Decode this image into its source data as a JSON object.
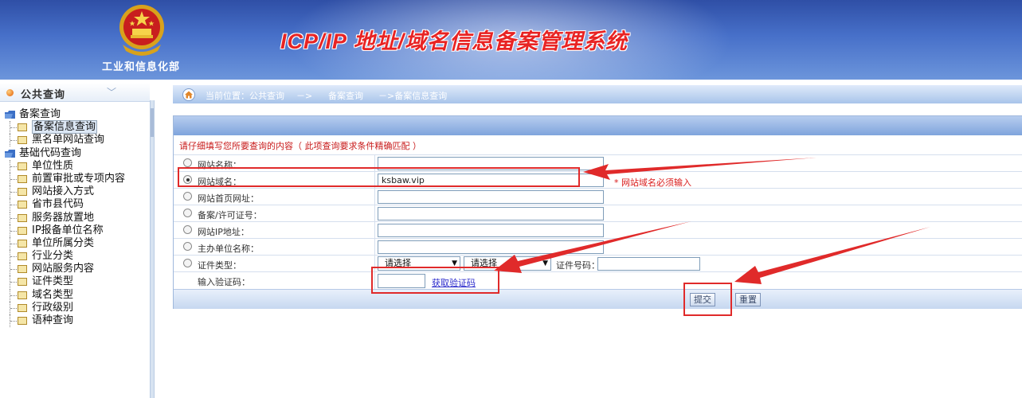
{
  "banner": {
    "ministry": "工业和信息化部",
    "title": "ICP/IP 地址/域名信息备案管理系统"
  },
  "sidebar": {
    "header": "公共查询",
    "tree": [
      {
        "label": "备案查询",
        "type": "folder"
      },
      {
        "label": "备案信息查询",
        "type": "leaf",
        "selected": true
      },
      {
        "label": "黑名单网站查询",
        "type": "leaf"
      },
      {
        "label": "基础代码查询",
        "type": "folder"
      },
      {
        "label": "单位性质",
        "type": "leaf"
      },
      {
        "label": "前置审批或专项内容",
        "type": "leaf"
      },
      {
        "label": "网站接入方式",
        "type": "leaf"
      },
      {
        "label": "省市县代码",
        "type": "leaf"
      },
      {
        "label": "服务器放置地",
        "type": "leaf"
      },
      {
        "label": "IP报备单位名称",
        "type": "leaf"
      },
      {
        "label": "单位所属分类",
        "type": "leaf"
      },
      {
        "label": "行业分类",
        "type": "leaf"
      },
      {
        "label": "网站服务内容",
        "type": "leaf"
      },
      {
        "label": "证件类型",
        "type": "leaf"
      },
      {
        "label": "域名类型",
        "type": "leaf"
      },
      {
        "label": "行政级别",
        "type": "leaf"
      },
      {
        "label": "语种查询",
        "type": "leaf"
      }
    ]
  },
  "breadcrumb": {
    "prefix": "当前位置：公共查询",
    "sep1": "－>",
    "middle": "备案查询",
    "last": "－>备案信息查询"
  },
  "form": {
    "hint": "请仔细填写您所要查询的内容（ 此项查询要求条件精确匹配 ）",
    "fields": [
      {
        "label": "网站名称：",
        "value": "",
        "checked": false
      },
      {
        "label": "网站域名：",
        "value": "ksbaw.vip",
        "checked": true
      },
      {
        "label": "网站首页网址：",
        "value": "",
        "checked": false
      },
      {
        "label": "备案/许可证号：",
        "value": "",
        "checked": false
      },
      {
        "label": "网站IP地址：",
        "value": "",
        "checked": false
      },
      {
        "label": "主办单位名称：",
        "value": "",
        "checked": false
      }
    ],
    "required_note": "* 网站域名必须输入",
    "cert": {
      "label": "证件类型：",
      "select1": "请选择",
      "select2": "请选择",
      "number_label": "证件号码："
    },
    "captcha": {
      "label": "输入验证码：",
      "link": "获取验证码"
    },
    "submit": "提交",
    "reset": "重置"
  },
  "colors": {
    "banner_top": "#2f4fa6",
    "title_red": "#e82323",
    "annotation_red": "#e02a2a",
    "hint_red": "#c81919"
  }
}
